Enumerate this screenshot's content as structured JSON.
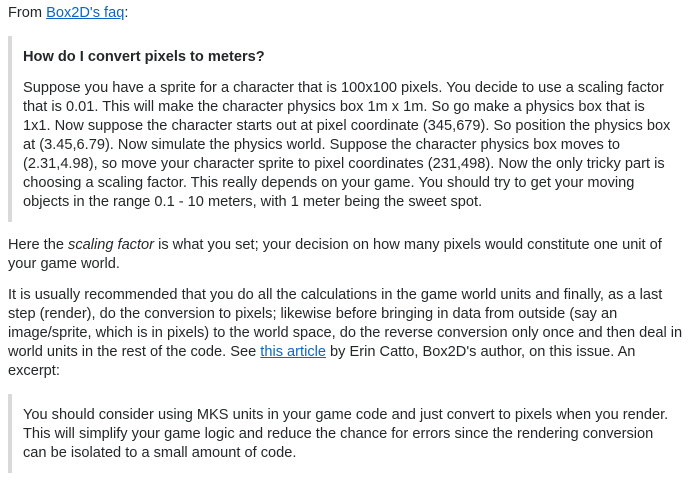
{
  "intro": {
    "prefix": "From ",
    "link_text": "Box2D's faq",
    "suffix": ":"
  },
  "quote1": {
    "heading": "How do I convert pixels to meters?",
    "body": "Suppose you have a sprite for a character that is 100x100 pixels. You decide to use a scaling factor that is 0.01. This will make the character physics box 1m x 1m. So go make a physics box that is 1x1. Now suppose the character starts out at pixel coordinate (345,679). So position the physics box at (3.45,6.79). Now simulate the physics world. Suppose the character physics box moves to (2.31,4.98), so move your character sprite to pixel coordinates (231,498). Now the only tricky part is choosing a scaling factor. This really depends on your game. You should try to get your moving objects in the range 0.1 - 10 meters, with 1 meter being the sweet spot."
  },
  "para1": {
    "prefix": "Here the ",
    "emphasis": "scaling factor",
    "suffix": " is what you set; your decision on how many pixels would constitute one unit of your game world."
  },
  "para2": {
    "prefix": "It is usually recommended that you do all the calculations in the game world units and finally, as a last step (render), do the conversion to pixels; likewise before bringing in data from outside (say an image/sprite, which is in pixels) to the world space, do the reverse conversion only once and then deal in world units in the rest of the code. See ",
    "link_text": "this article",
    "suffix": " by Erin Catto, Box2D's author, on this issue. An excerpt:"
  },
  "quote2": {
    "body": "You should consider using MKS units in your game code and just convert to pixels when you render. This will simplify your game logic and reduce the chance for errors since the rendering conversion can be isolated to a small amount of code."
  }
}
